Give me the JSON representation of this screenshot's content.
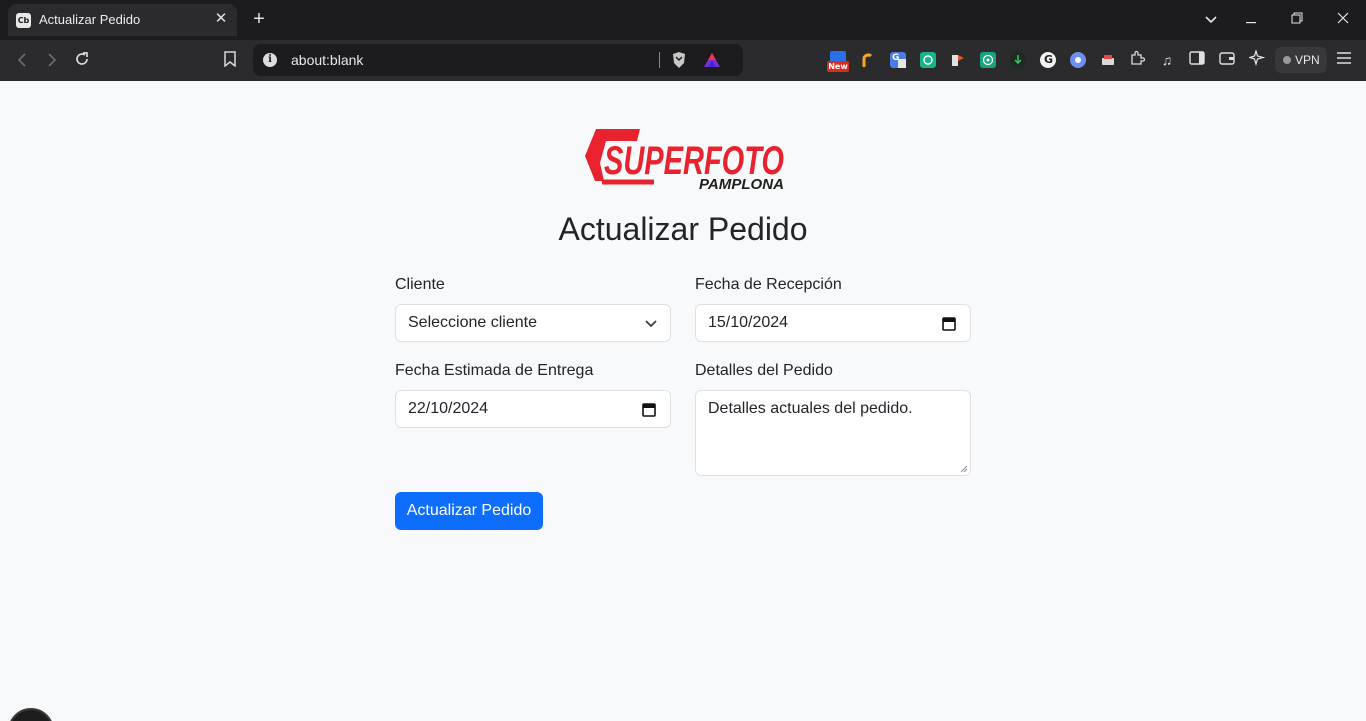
{
  "browser": {
    "tab": {
      "title": "Actualizar Pedido",
      "favicon_text": "Cb"
    },
    "address": "about:blank",
    "vpn_label": "VPN",
    "ext_new_badge": "New"
  },
  "logo": {
    "brand": "SUPERFOTO",
    "city": "PAMPLONA"
  },
  "form": {
    "title": "Actualizar Pedido",
    "cliente": {
      "label": "Cliente",
      "value": "Seleccione cliente"
    },
    "fecha_recepcion": {
      "label": "Fecha de Recepción",
      "value": "15/10/2024"
    },
    "fecha_entrega": {
      "label": "Fecha Estimada de Entrega",
      "value": "22/10/2024"
    },
    "detalles": {
      "label": "Detalles del Pedido",
      "value": "Detalles actuales del pedido."
    },
    "submit_label": "Actualizar Pedido"
  },
  "colors": {
    "primary": "#0d6efd",
    "logo_red": "#e8222e",
    "page_bg": "#f8f9fa"
  }
}
